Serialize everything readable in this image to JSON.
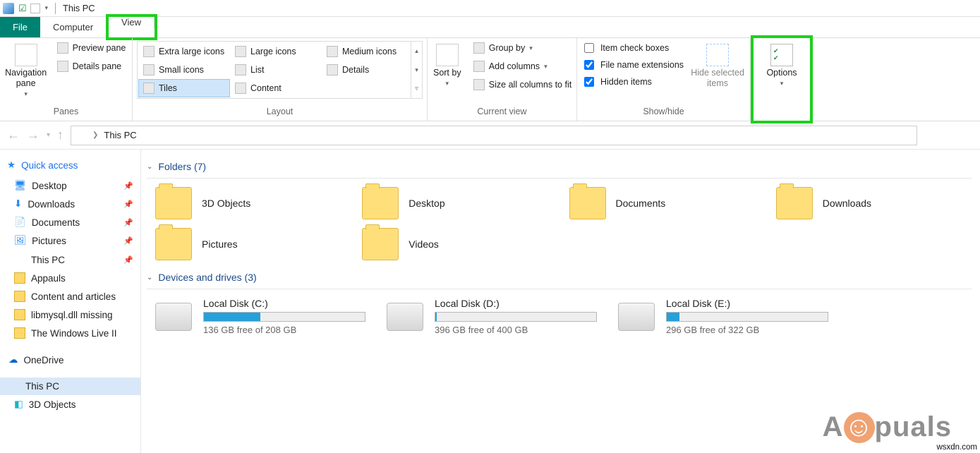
{
  "title": "This PC",
  "tabs": {
    "file": "File",
    "computer": "Computer",
    "view": "View"
  },
  "ribbon": {
    "panes": {
      "label": "Panes",
      "navpane": "Navigation pane",
      "preview": "Preview pane",
      "details": "Details pane"
    },
    "layout": {
      "label": "Layout",
      "modes": [
        "Extra large icons",
        "Large icons",
        "Medium icons",
        "Small icons",
        "List",
        "Details",
        "Tiles",
        "Content"
      ],
      "selected": "Tiles"
    },
    "currentview": {
      "label": "Current view",
      "sortby": "Sort by",
      "groupby": "Group by",
      "addcols": "Add columns",
      "sizefit": "Size all columns to fit"
    },
    "showhide": {
      "label": "Show/hide",
      "itemcheck": {
        "label": "Item check boxes",
        "checked": false
      },
      "fileext": {
        "label": "File name extensions",
        "checked": true
      },
      "hidden": {
        "label": "Hidden items",
        "checked": true
      },
      "hidesel": "Hide selected items"
    },
    "options": "Options"
  },
  "breadcrumb": {
    "location": "This PC"
  },
  "sidebar": {
    "quickaccess": "Quick access",
    "pinned": [
      "Desktop",
      "Downloads",
      "Documents",
      "Pictures"
    ],
    "items": [
      "This PC",
      "Appauls",
      "Content and articles",
      "libmysql.dll missing",
      "The Windows Live II"
    ],
    "onedrive": "OneDrive",
    "thispc": "This PC",
    "sub": "3D Objects"
  },
  "sections": {
    "folders": {
      "title": "Folders (7)",
      "items": [
        "3D Objects",
        "Desktop",
        "Documents",
        "Downloads",
        "Pictures",
        "Videos"
      ]
    },
    "drives": {
      "title": "Devices and drives (3)",
      "items": [
        {
          "name": "Local Disk (C:)",
          "free": "136 GB free of 208 GB",
          "pct": 35
        },
        {
          "name": "Local Disk (D:)",
          "free": "396 GB free of 400 GB",
          "pct": 1
        },
        {
          "name": "Local Disk (E:)",
          "free": "296 GB free of 322 GB",
          "pct": 8
        }
      ]
    }
  },
  "watermark": "wsxdn.com",
  "brand": "A  puals"
}
